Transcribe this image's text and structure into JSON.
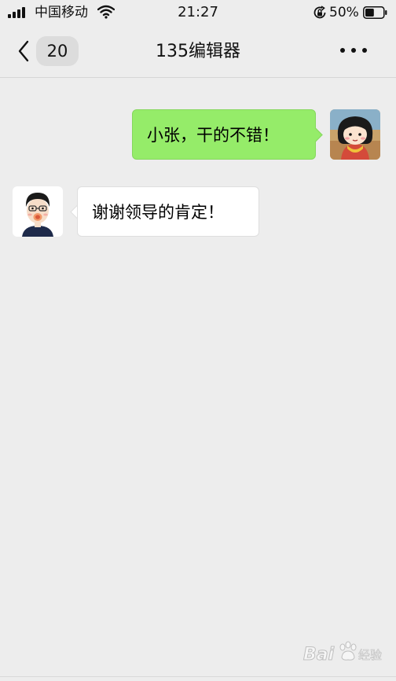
{
  "status_bar": {
    "carrier": "中国移动",
    "time": "21:27",
    "battery_percent": "50%",
    "battery_level": 0.5,
    "icons": [
      "signal-icon",
      "wifi-icon",
      "rotation-lock-icon",
      "battery-icon"
    ]
  },
  "nav": {
    "back_icon": "chevron-left-icon",
    "unread_count": "20",
    "title": "135编辑器",
    "more_icon": "more-dots-icon"
  },
  "messages": [
    {
      "side": "right",
      "text": "小张，干的不错！",
      "avatar": "cartoon-girl-avatar"
    },
    {
      "side": "left",
      "text": "谢谢领导的肯定！",
      "avatar": "cartoon-boy-avatar"
    }
  ],
  "watermark": {
    "text": "Bai",
    "text_suffix": "经验",
    "icon": "paw-icon"
  },
  "colors": {
    "background": "#ededed",
    "sent_bubble": "#95ec69",
    "received_bubble": "#ffffff",
    "text": "#111111"
  }
}
